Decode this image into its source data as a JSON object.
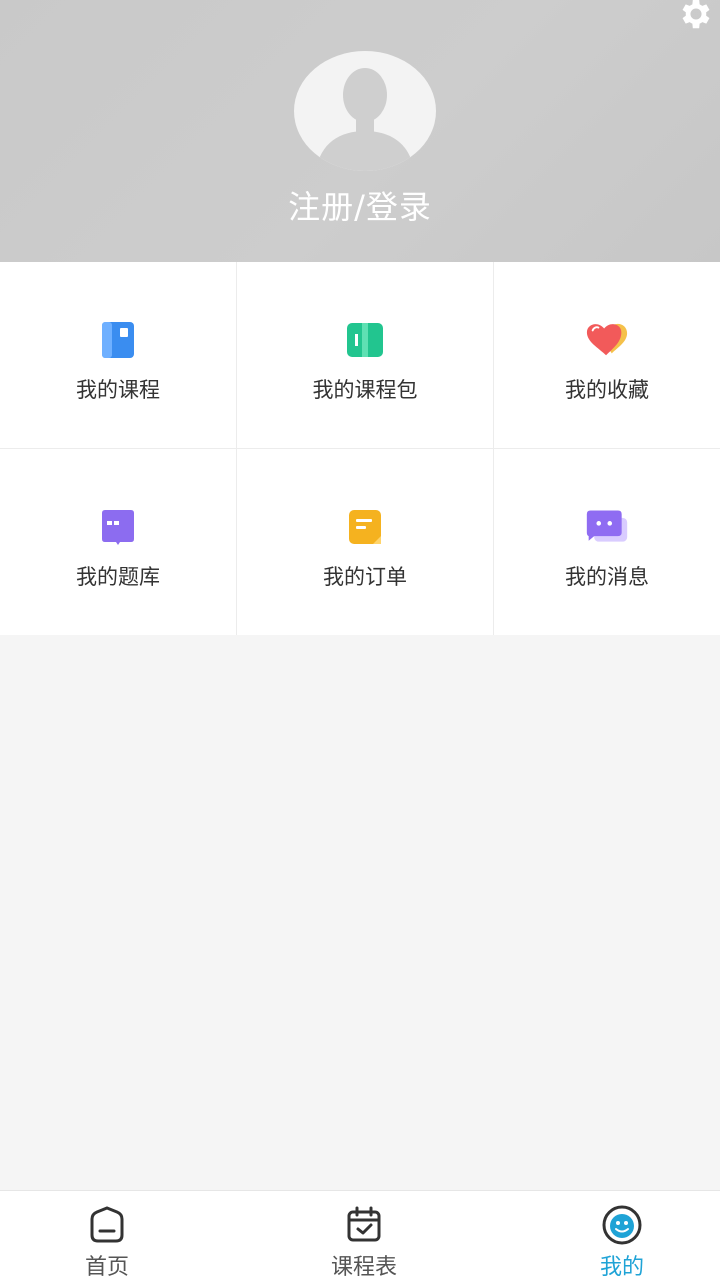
{
  "header": {
    "login_label": "注册/登录"
  },
  "menu": [
    {
      "label": "我的课程",
      "icon": "course-book-icon"
    },
    {
      "label": "我的课程包",
      "icon": "course-package-icon"
    },
    {
      "label": "我的收藏",
      "icon": "heart-icon"
    },
    {
      "label": "我的题库",
      "icon": "question-bank-icon"
    },
    {
      "label": "我的订单",
      "icon": "order-icon"
    },
    {
      "label": "我的消息",
      "icon": "message-icon"
    }
  ],
  "tabbar": {
    "tabs": [
      {
        "label": "首页",
        "icon": "home-icon"
      },
      {
        "label": "课程表",
        "icon": "calendar-icon"
      },
      {
        "label": "我的",
        "icon": "profile-icon"
      }
    ],
    "active": "我的"
  },
  "colors": {
    "header_bg": "#c9c9c9",
    "active_tab": "#1fa3d6",
    "course_blue": "#3a8df0",
    "package_green": "#22c58f",
    "heart_red": "#f25a5a",
    "heart_yellow": "#f5c14a",
    "bank_purple": "#8c6cf0",
    "order_orange": "#f5b21f",
    "message_purple": "#8f6cf2"
  }
}
